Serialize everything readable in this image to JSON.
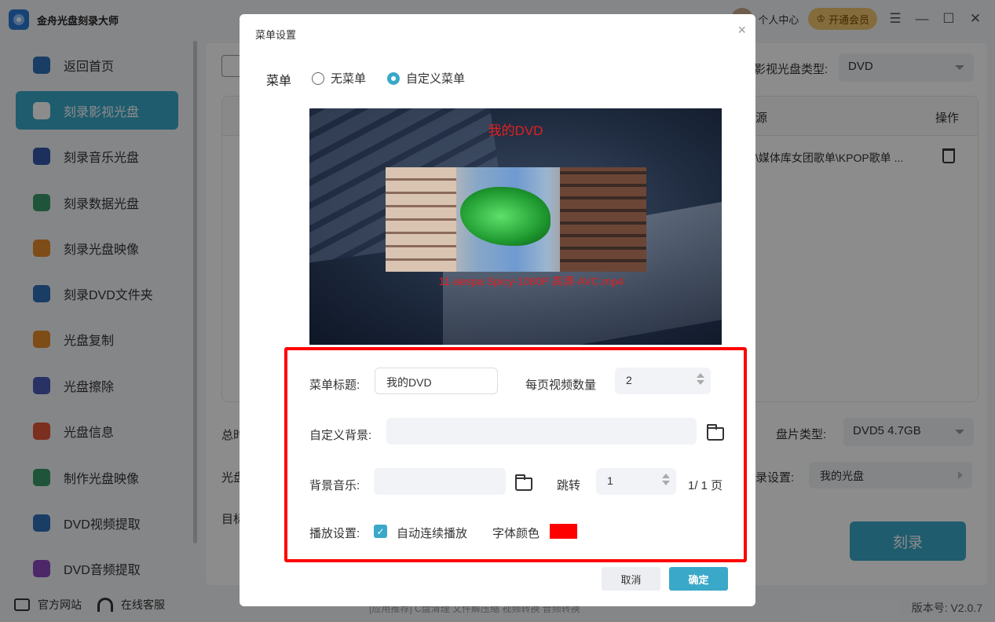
{
  "app": {
    "title": "金舟光盘刻录大师",
    "user_center": "个人中心",
    "vip_label": "开通会员",
    "version": "版本号: V2.0.7"
  },
  "sidebar": {
    "items": [
      {
        "label": "返回首页",
        "icon": "home-icon",
        "color": "#2f6fb8"
      },
      {
        "label": "刻录影视光盘",
        "icon": "video-disc-icon",
        "color": "#2a8fb8",
        "active": true
      },
      {
        "label": "刻录音乐光盘",
        "icon": "music-disc-icon",
        "color": "#3556a8"
      },
      {
        "label": "刻录数据光盘",
        "icon": "data-disc-icon",
        "color": "#3b9a6a"
      },
      {
        "label": "刻录光盘映像",
        "icon": "disc-image-icon",
        "color": "#e58a2a"
      },
      {
        "label": "刻录DVD文件夹",
        "icon": "dvd-folder-icon",
        "color": "#2f6fb8"
      },
      {
        "label": "光盘复制",
        "icon": "disc-copy-icon",
        "color": "#e58a2a"
      },
      {
        "label": "光盘擦除",
        "icon": "disc-erase-icon",
        "color": "#4a5bb8"
      },
      {
        "label": "光盘信息",
        "icon": "disc-info-icon",
        "color": "#e2553a"
      },
      {
        "label": "制作光盘映像",
        "icon": "make-image-icon",
        "color": "#3b9a6a"
      },
      {
        "label": "DVD视频提取",
        "icon": "dvd-video-extract-icon",
        "color": "#2f6fb8"
      },
      {
        "label": "DVD音频提取",
        "icon": "dvd-audio-extract-icon",
        "color": "#8a4ac0"
      }
    ],
    "footer_site": "官方网站",
    "footer_service": "在线客服"
  },
  "background": {
    "disc_type_label": "影视光盘类型:",
    "disc_type_value": "DVD",
    "col_source": "源",
    "col_action": "操作",
    "row_path": "\\媒体库女团歌单\\KPOP歌单 ...",
    "total_label": "总时",
    "disc_label": "光盘",
    "target_label": "目标",
    "plate_type_label": "盘片类型:",
    "plate_type_value": "DVD5 4.7GB",
    "record_setting_label": "录设置:",
    "record_setting_value": "我的光盘",
    "burn_button": "刻录",
    "footer_text": "[应用推荐]  C盘清理  文件解压缩  视频转换  音频转换"
  },
  "dialog": {
    "title": "菜单设置",
    "close": "×",
    "menu_label": "菜单",
    "radio_none": "无菜单",
    "radio_custom": "自定义菜单",
    "preview_title": "我的DVD",
    "preview_caption": "11-aespa Spicy-1080P 高清-AVC.mp4",
    "menu_title_label": "菜单标题:",
    "menu_title_value": "我的DVD",
    "per_page_label": "每页视频数量",
    "per_page_value": "2",
    "custom_bg_label": "自定义背景:",
    "custom_bg_value": "",
    "bg_music_label": "背景音乐:",
    "bg_music_value": "",
    "jump_label": "跳转",
    "jump_value": "1",
    "page_info": "1/ 1 页",
    "play_setting_label": "播放设置:",
    "autoplay_label": "自动连续播放",
    "autoplay_checked": true,
    "font_color_label": "字体颜色",
    "font_color": "#ff0000",
    "cancel": "取消",
    "ok": "确定"
  }
}
